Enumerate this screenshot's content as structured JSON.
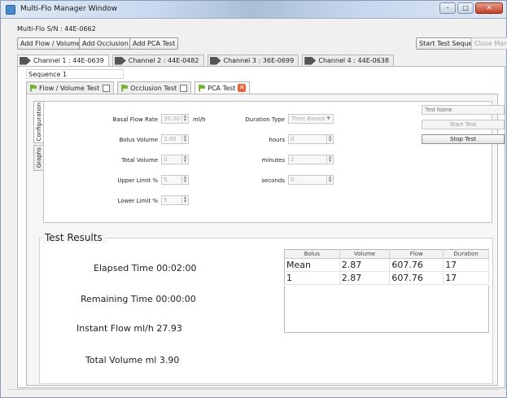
{
  "window": {
    "title": "Multi-Flo Manager Window",
    "min_label": "–",
    "max_label": "□",
    "close_label": "✕"
  },
  "serial": "Multi-Flo S/N : 44E-0662",
  "toolbar": {
    "add_flow_volume": "Add Flow / Volume Test",
    "add_occlusion": "Add Occlusion Test",
    "add_pca": "Add PCA Test",
    "start_sequence": "Start Test Sequence",
    "close_manager": "Close Manager"
  },
  "channels": [
    {
      "label": "Channel 1 : 44E-0639"
    },
    {
      "label": "Channel 2 : 44E-0482"
    },
    {
      "label": "Channel 3 : 36E-0699"
    },
    {
      "label": "Channel 4 : 44E-0638"
    }
  ],
  "sequence_value": "Sequence 1",
  "test_tabs": [
    {
      "label": "Flow / Volume Test"
    },
    {
      "label": "Occlusion Test"
    },
    {
      "label": "PCA Test"
    }
  ],
  "side_tabs": {
    "configuration": "Configuration",
    "graphs": "Graphs"
  },
  "form": {
    "basal_flow_rate_label": "Basal Flow Rate",
    "basal_flow_rate_value": "30.00",
    "basal_flow_rate_unit": "ml/h",
    "bolus_volume_label": "Bolus Volume",
    "bolus_volume_value": "3.00",
    "total_volume_label": "Total Volume",
    "total_volume_value": "0",
    "upper_limit_label": "Upper Limit %",
    "upper_limit_value": "5",
    "lower_limit_label": "Lower Limit %",
    "lower_limit_value": "5",
    "duration_type_label": "Duration Type",
    "duration_type_value": "Time Based",
    "hours_label": "hours",
    "hours_value": "0",
    "minutes_label": "minutes",
    "minutes_value": "2",
    "seconds_label": "seconds",
    "seconds_value": "0",
    "test_name_placeholder": "Test Name",
    "start_test": "Start Test",
    "stop_test": "Stop Test",
    "spin_up": "▲",
    "spin_down": "▼",
    "combo_arrow": "▼"
  },
  "results": {
    "title": "Test Results",
    "elapsed": "Elapsed Time 00:02:00",
    "remaining": "Remaining Time 00:00:00",
    "instant_flow": "Instant Flow ml/h 27.93",
    "total_volume": "Total Volume ml 3.90",
    "columns": [
      "Bolus",
      "Volume",
      "Flow",
      "Duration"
    ],
    "rows": [
      [
        "Mean",
        "2.87",
        "607.76",
        "17"
      ],
      [
        "1",
        "2.87",
        "607.76",
        "17"
      ]
    ]
  },
  "colors": {
    "flag_green": "#6fb52c",
    "close_red": "#e8633a",
    "title_blue": "#c9d9ee"
  }
}
